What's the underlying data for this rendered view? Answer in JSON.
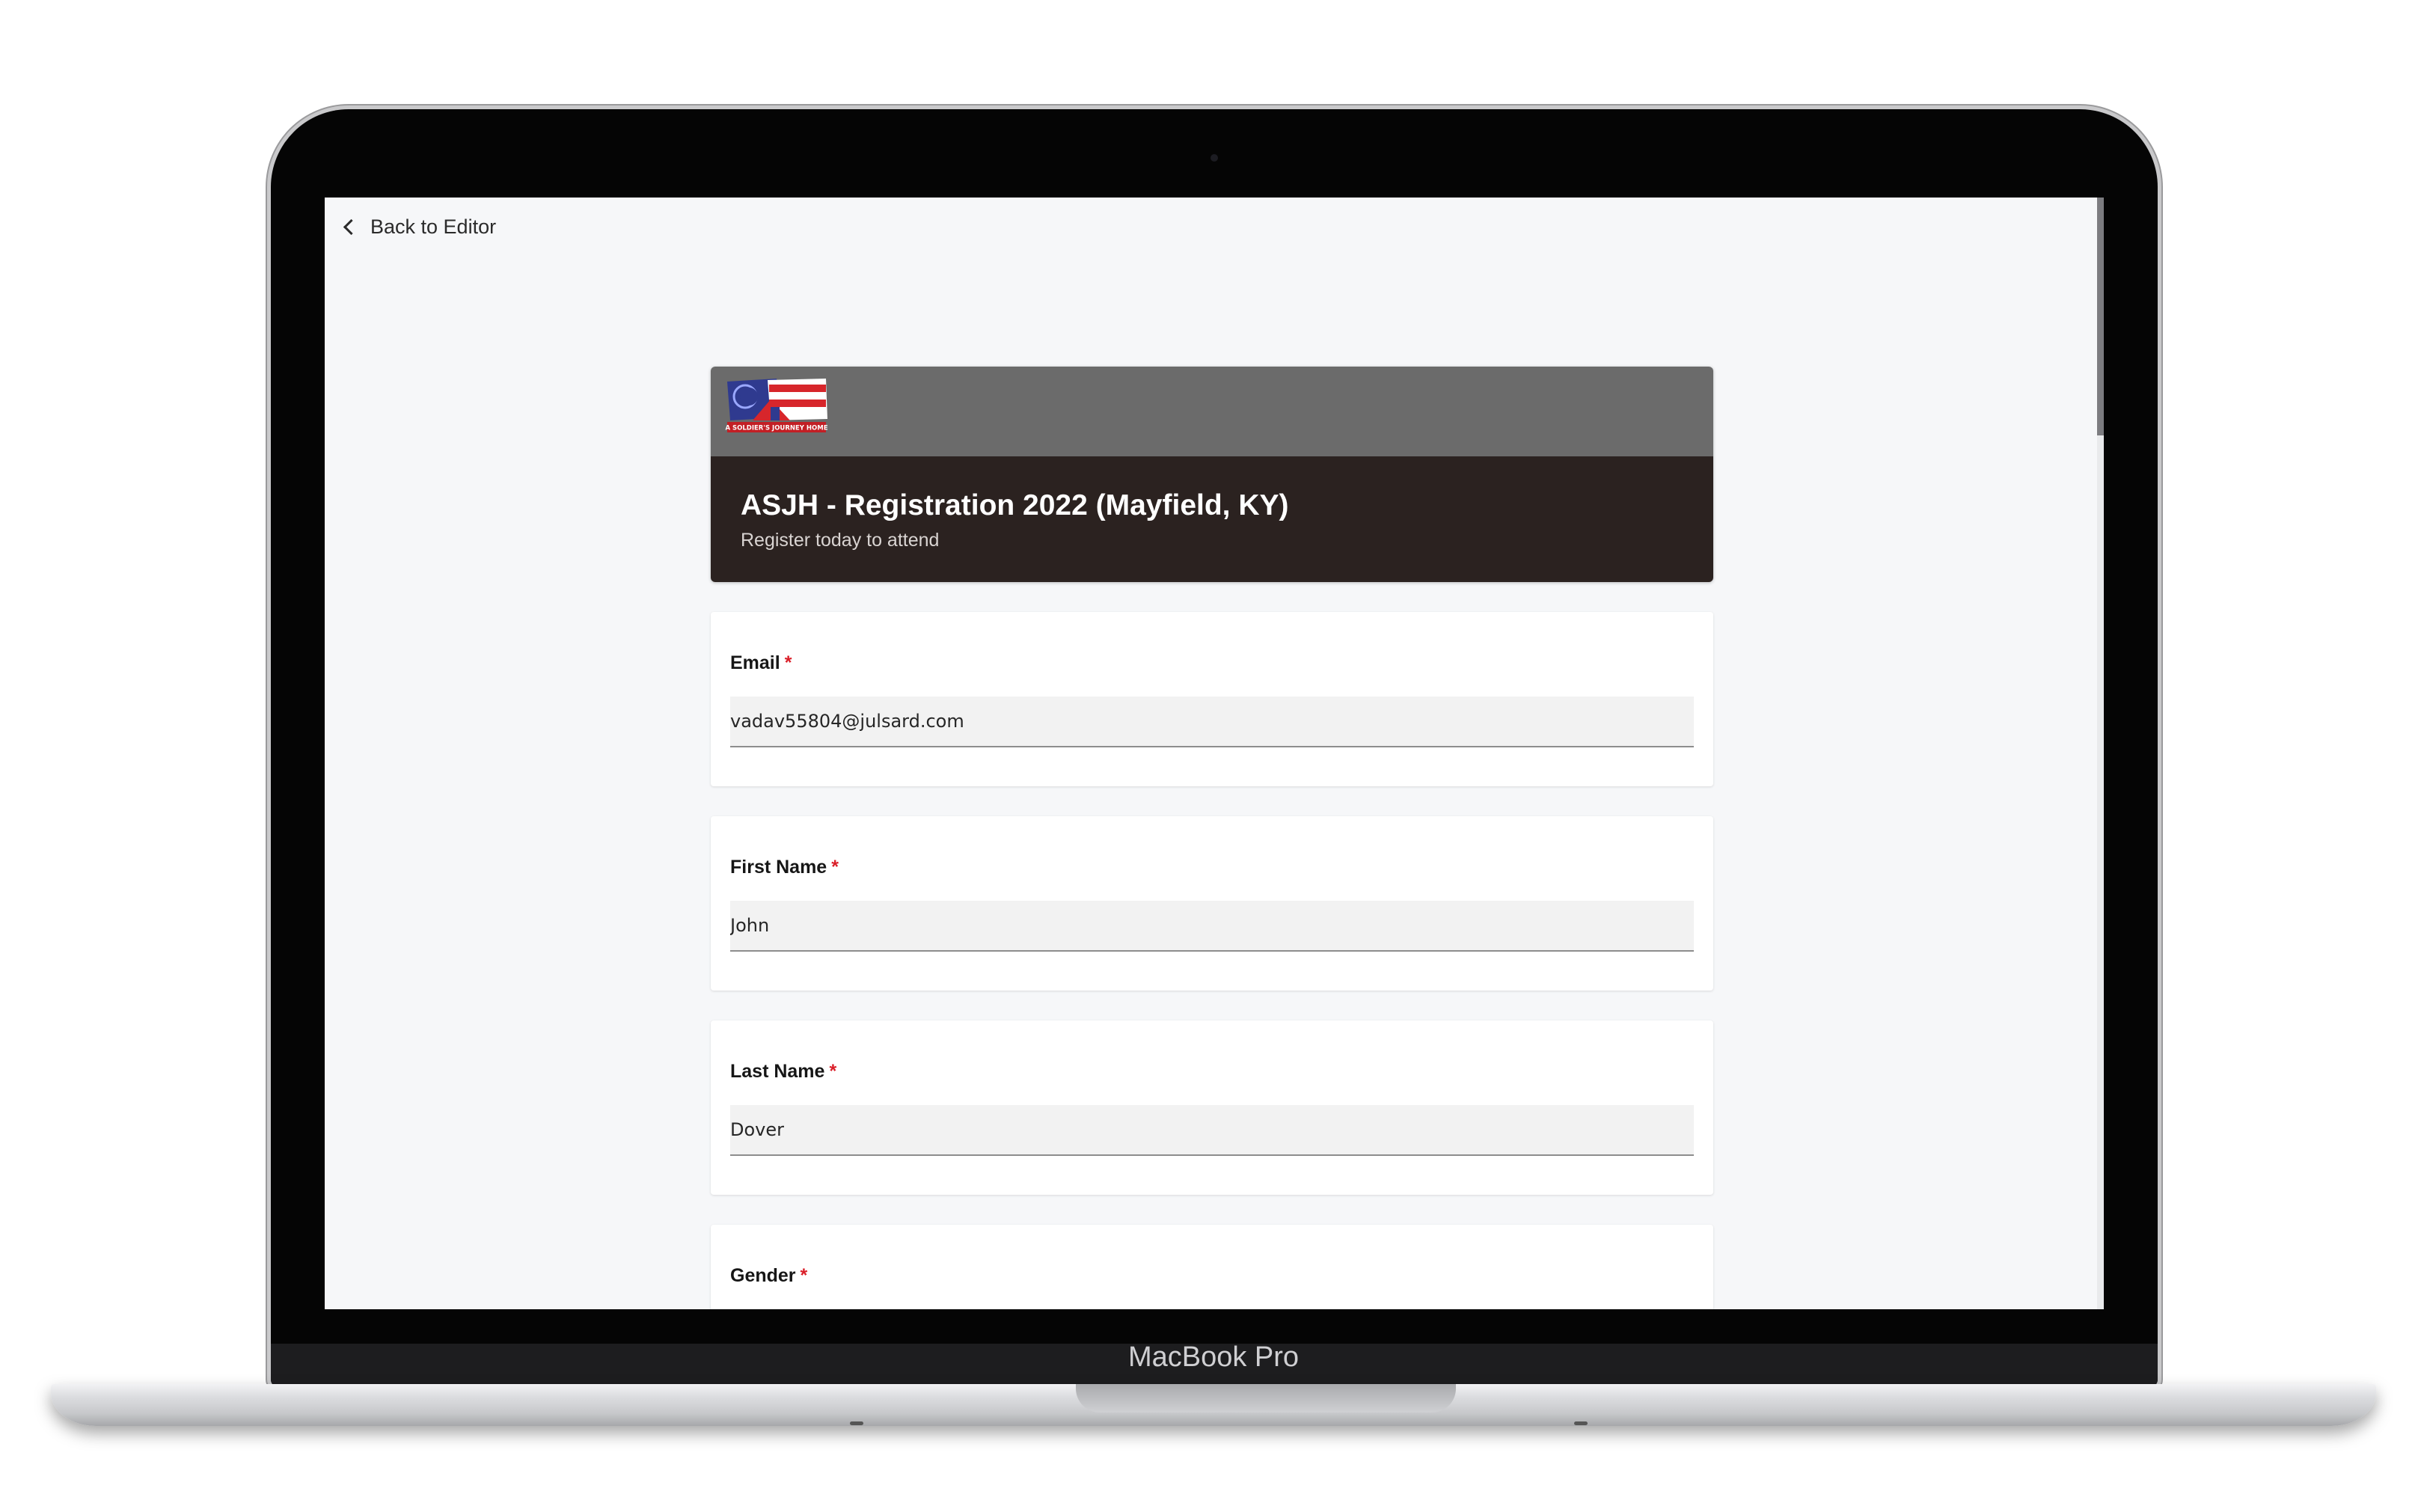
{
  "device": {
    "brand_label": "MacBook Pro"
  },
  "nav": {
    "back_label": "Back to Editor"
  },
  "form": {
    "title": "ASJH - Registration 2022 (Mayfield, KY)",
    "subtitle": "Register today to attend",
    "logo_text": "A SOLDIER'S JOURNEY HOME",
    "colors": {
      "header_band": "#6b6b6b",
      "header_body": "#2b2220",
      "required": "#da1e28"
    },
    "fields": [
      {
        "label": "Email",
        "required_mark": "*",
        "value": "vadav55804@julsard.com"
      },
      {
        "label": "First Name",
        "required_mark": "*",
        "value": "John"
      },
      {
        "label": "Last Name",
        "required_mark": "*",
        "value": "Dover"
      },
      {
        "label": "Gender",
        "required_mark": "*"
      }
    ]
  }
}
